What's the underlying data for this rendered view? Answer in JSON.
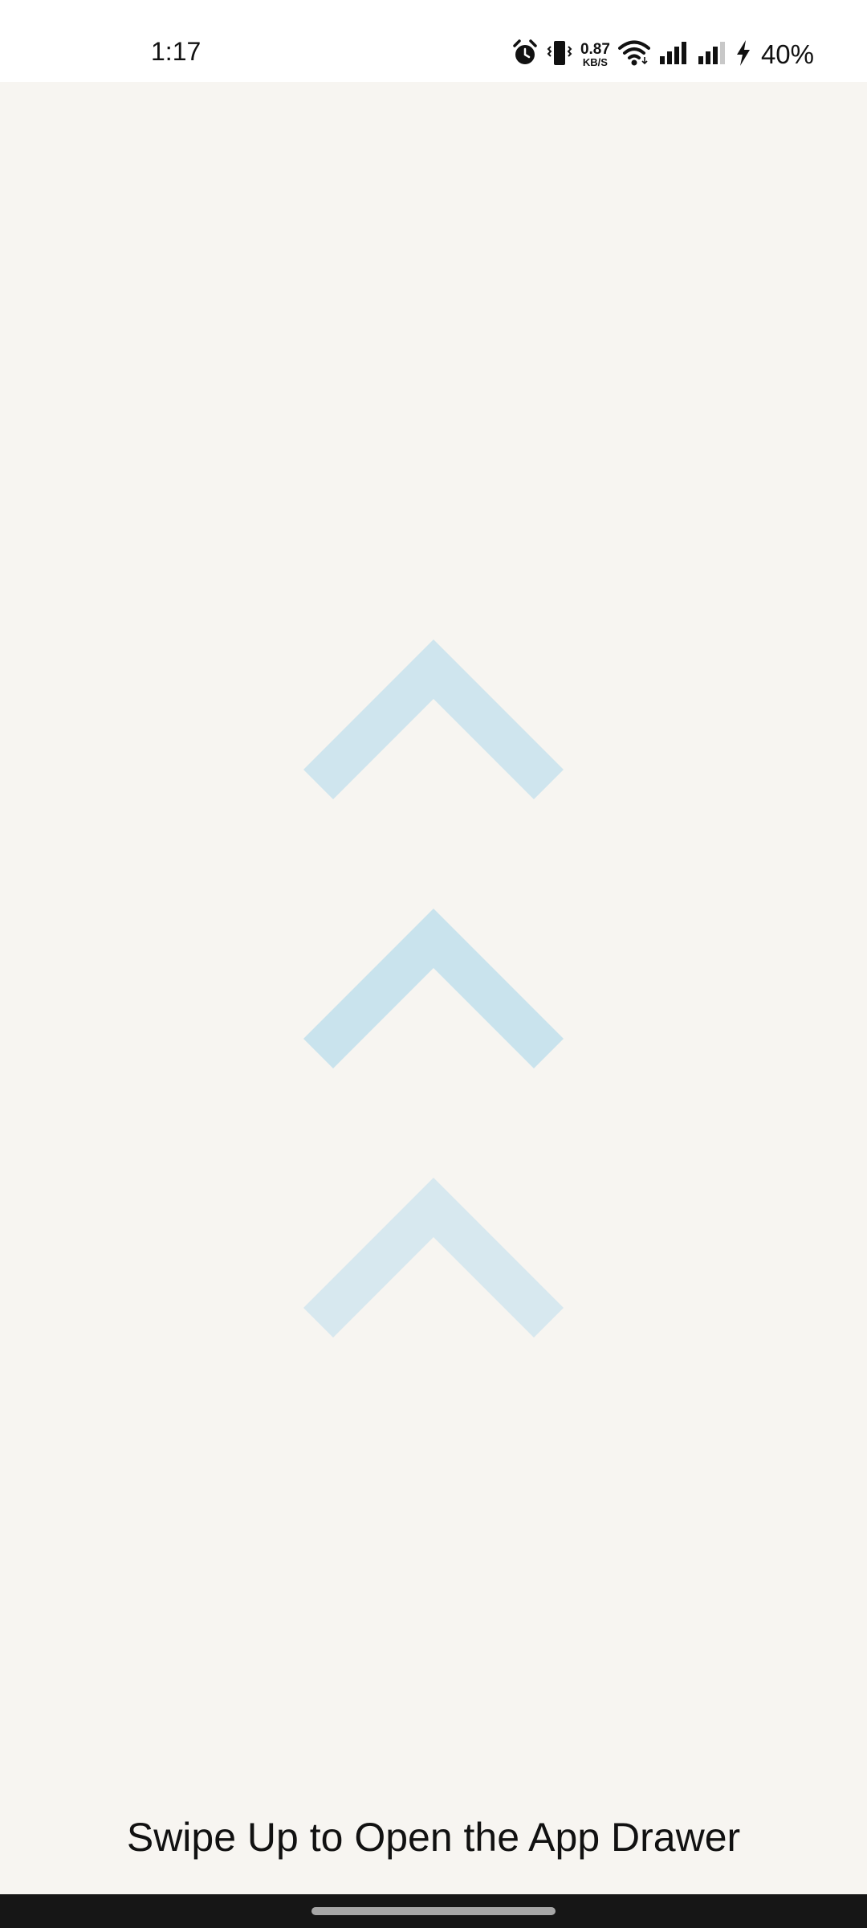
{
  "status_bar": {
    "time": "1:17",
    "net_speed_value": "0.87",
    "net_speed_unit": "KB/S",
    "battery_percent": "40%",
    "icons": [
      "alarm-icon",
      "vibrate-icon",
      "wifi-icon",
      "signal-1-icon",
      "signal-2-icon",
      "charging-icon"
    ]
  },
  "main": {
    "chevrons": [
      {
        "name": "chevron-up-icon",
        "color": "#cfe5ee"
      },
      {
        "name": "chevron-up-icon",
        "color": "#c9e3ed"
      },
      {
        "name": "chevron-up-icon",
        "color": "#d7e8ef"
      }
    ],
    "hint": "Swipe Up to Open the App Drawer",
    "background": "#f7f5f1"
  },
  "navigation": {
    "gesture_pill": "gesture-handle"
  }
}
